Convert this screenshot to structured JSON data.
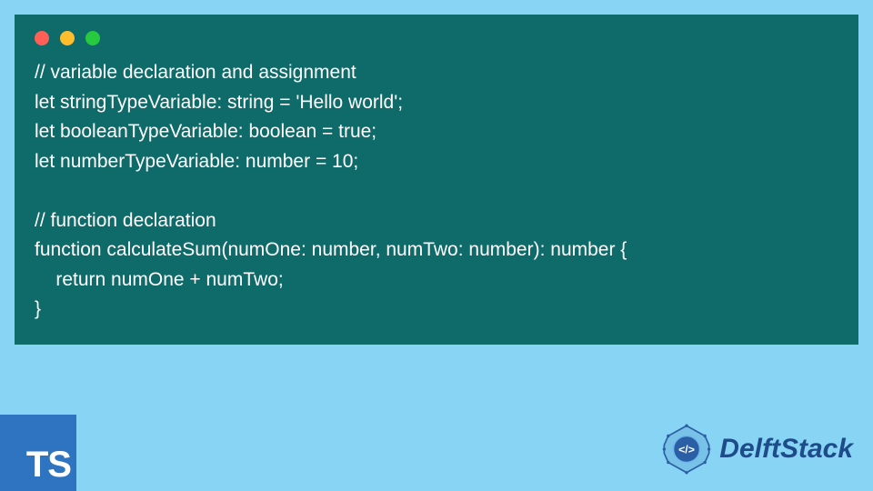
{
  "code": {
    "lines": [
      "// variable declaration and assignment",
      "let stringTypeVariable: string = 'Hello world';",
      "let booleanTypeVariable: boolean = true;",
      "let numberTypeVariable: number = 10;",
      "",
      "// function declaration",
      "function calculateSum(numOne: number, numTwo: number): number {",
      "    return numOne + numTwo;",
      "}"
    ]
  },
  "badge": {
    "label": "TS"
  },
  "brand": {
    "name": "DelftStack"
  },
  "colors": {
    "page_bg": "#88d4f4",
    "window_bg": "#0f6b6a",
    "code_text": "#ffffff",
    "badge_bg": "#2f74c0",
    "brand_text": "#1e4b8a"
  }
}
